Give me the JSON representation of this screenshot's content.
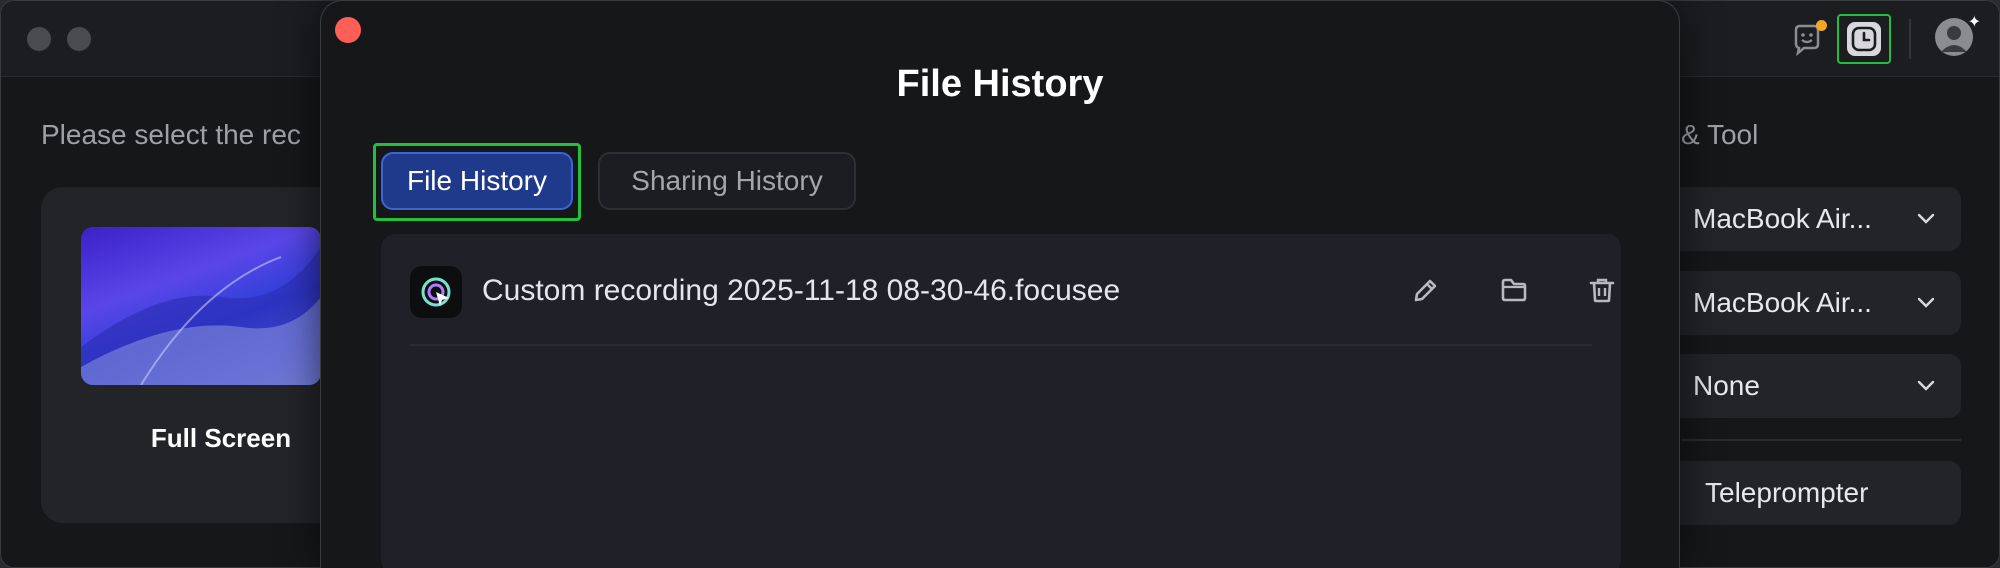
{
  "main": {
    "prompt": "Please select the rec",
    "mode_card": {
      "label": "Full Screen"
    },
    "right_panel": {
      "title": "& Tool",
      "camera_select": "MacBook Air...",
      "mic_select": "MacBook Air...",
      "system_audio_select": "None",
      "teleprompter_label": "Teleprompter"
    }
  },
  "titlebar": {
    "icons": [
      "feedback-icon",
      "history-icon",
      "avatar"
    ],
    "notification_color": "#f5a623",
    "highlight_color": "#22c03a"
  },
  "modal": {
    "title": "File History",
    "tabs": [
      {
        "label": "File History",
        "active": true
      },
      {
        "label": "Sharing History",
        "active": false
      }
    ],
    "files": [
      {
        "name": "Custom recording 2025-11-18 08-30-46.focusee",
        "actions": [
          "edit-icon",
          "folder-icon",
          "trash-icon"
        ]
      }
    ],
    "accent_color": "#1f3a8a",
    "close_color": "#ff5f57"
  }
}
